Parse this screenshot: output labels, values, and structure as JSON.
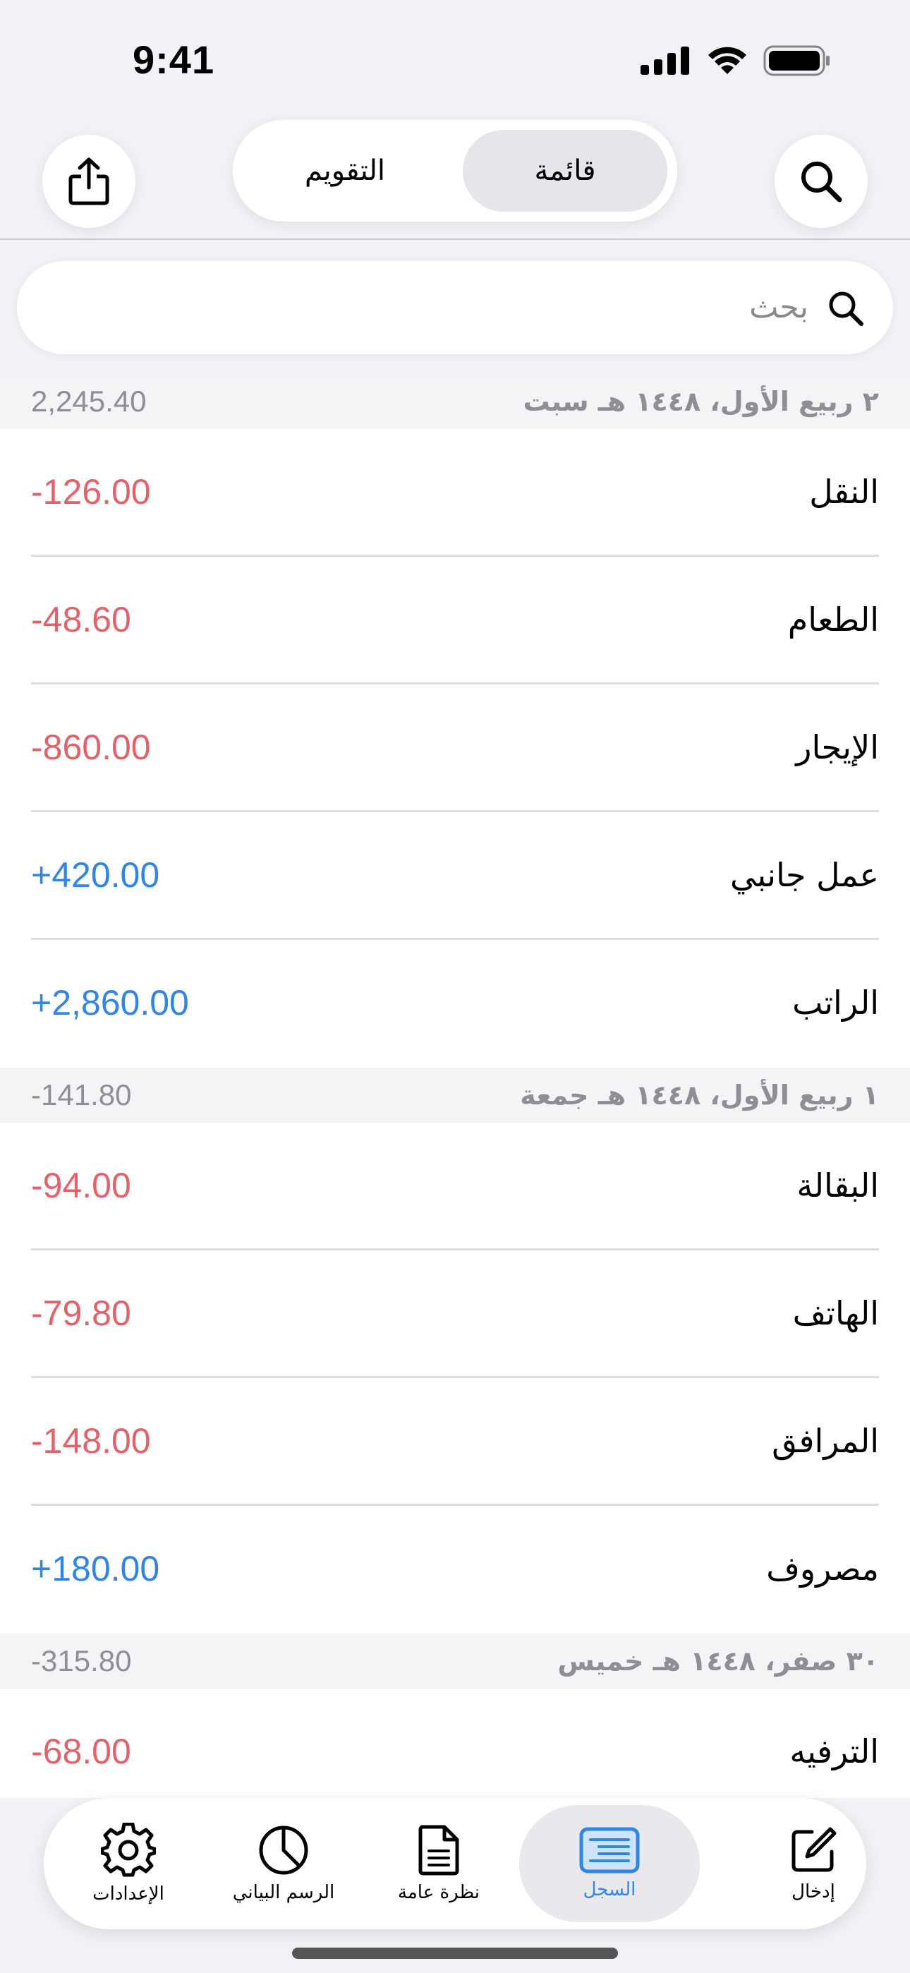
{
  "status_bar": {
    "time": "9:41"
  },
  "header": {
    "segments": {
      "list": "قائمة",
      "calendar": "التقويم"
    },
    "selected_segment": "list"
  },
  "search": {
    "placeholder": "بحث"
  },
  "sections": [
    {
      "date": "٢ ربيع الأول، ١٤٤٨ هـ سبت",
      "total": "2,245.40",
      "rows": [
        {
          "label": "النقل",
          "amount": "-126.00",
          "type": "neg"
        },
        {
          "label": "الطعام",
          "amount": "-48.60",
          "type": "neg"
        },
        {
          "label": "الإيجار",
          "amount": "-860.00",
          "type": "neg"
        },
        {
          "label": "عمل جانبي",
          "amount": "+420.00",
          "type": "pos"
        },
        {
          "label": "الراتب",
          "amount": "+2,860.00",
          "type": "pos"
        }
      ]
    },
    {
      "date": "١ ربيع الأول، ١٤٤٨ هـ جمعة",
      "total": "-141.80",
      "rows": [
        {
          "label": "البقالة",
          "amount": "-94.00",
          "type": "neg"
        },
        {
          "label": "الهاتف",
          "amount": "-79.80",
          "type": "neg"
        },
        {
          "label": "المرافق",
          "amount": "-148.00",
          "type": "neg"
        },
        {
          "label": "مصروف",
          "amount": "+180.00",
          "type": "pos"
        }
      ]
    },
    {
      "date": "٣٠ صفر، ١٤٤٨ هـ خميس",
      "total": "-315.80",
      "rows": [
        {
          "label": "الترفيه",
          "amount": "-68.00",
          "type": "neg"
        }
      ]
    }
  ],
  "tab_bar": {
    "tabs": [
      {
        "label": "إدخال",
        "icon": "edit-icon"
      },
      {
        "label": "السجل",
        "icon": "list-icon",
        "active": true
      },
      {
        "label": "نظرة عامة",
        "icon": "document-icon"
      },
      {
        "label": "الرسم البياني",
        "icon": "pie-chart-icon"
      },
      {
        "label": "الإعدادات",
        "icon": "gear-icon"
      }
    ]
  },
  "colors": {
    "negative": "#e5616a",
    "positive": "#2f86e8",
    "accent": "#2f86e8"
  }
}
